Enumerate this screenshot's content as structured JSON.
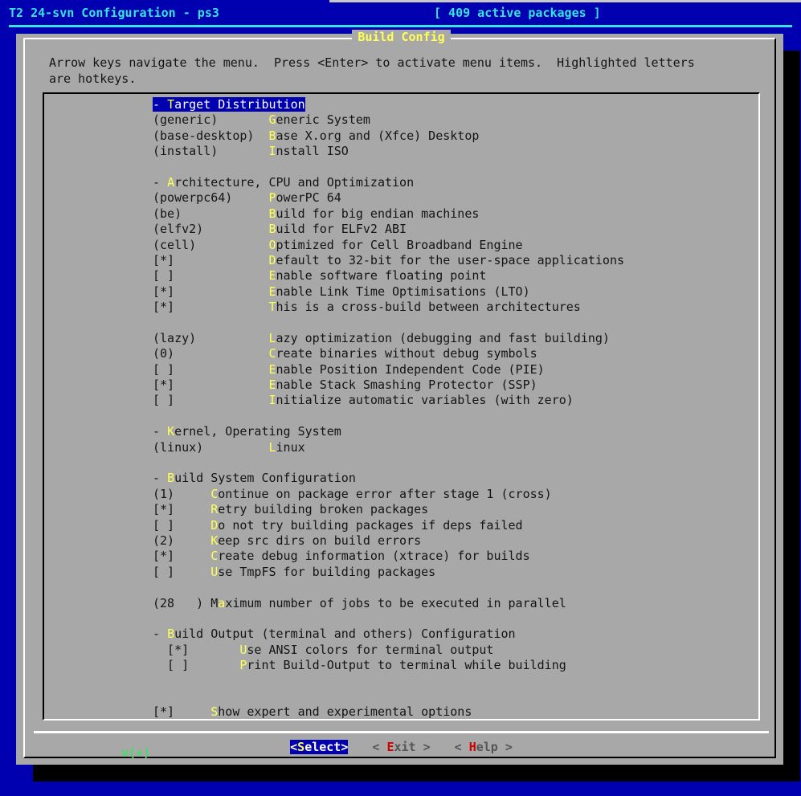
{
  "titlebar": {
    "left": "T2 24-svn Configuration - ps3",
    "right": "[ 409 active packages ]"
  },
  "dialog": {
    "title": "Build Config",
    "prompt_line1": "Arrow keys navigate the menu.  Press <Enter> to activate menu items.  Highlighted letters",
    "prompt_line2": "are hotkeys.",
    "scroll_indicator": "v(+)"
  },
  "colors": {
    "desktop_blue": "#0000b0",
    "dialog_gray": "#a8a8a8",
    "title_yellow": "#ffff55",
    "titlebar_cyan": "#33e5e5",
    "hotkey_yellow": "#ffff55",
    "highlight_blue": "#0000b0",
    "scroll_green": "#44e066",
    "button_hotkey_red": "#cc0000"
  },
  "menu": {
    "rows": [
      {
        "type": "item",
        "selected": true,
        "value": "- ",
        "hotkey": "T",
        "label": "arget Distribution"
      },
      {
        "type": "item",
        "selected": false,
        "value": "(generic)       ",
        "hotkey": "G",
        "label": "eneric System"
      },
      {
        "type": "item",
        "selected": false,
        "value": "(base-desktop)  ",
        "hotkey": "B",
        "label": "ase X.org and (Xfce) Desktop"
      },
      {
        "type": "item",
        "selected": false,
        "value": "(install)       ",
        "hotkey": "I",
        "label": "nstall ISO"
      },
      {
        "type": "blank"
      },
      {
        "type": "item",
        "selected": false,
        "value": "- ",
        "hotkey": "A",
        "label": "rchitecture, CPU and Optimization"
      },
      {
        "type": "item",
        "selected": false,
        "value": "(powerpc64)     ",
        "hotkey": "P",
        "label": "owerPC 64"
      },
      {
        "type": "item",
        "selected": false,
        "value": "(be)            ",
        "hotkey": "B",
        "label": "uild for big endian machines"
      },
      {
        "type": "item",
        "selected": false,
        "value": "(elfv2)         ",
        "hotkey": "B",
        "label": "uild for ELFv2 ABI"
      },
      {
        "type": "item",
        "selected": false,
        "value": "(cell)          ",
        "hotkey": "O",
        "label": "ptimized for Cell Broadband Engine"
      },
      {
        "type": "item",
        "selected": false,
        "value": "[*]             ",
        "hotkey": "D",
        "label": "efault to 32-bit for the user-space applications"
      },
      {
        "type": "item",
        "selected": false,
        "value": "[ ]             ",
        "hotkey": "E",
        "label": "nable software floating point"
      },
      {
        "type": "item",
        "selected": false,
        "value": "[*]             ",
        "hotkey": "E",
        "label": "nable Link Time Optimisations (LTO)"
      },
      {
        "type": "item",
        "selected": false,
        "value": "[*]             ",
        "hotkey": "T",
        "label": "his is a cross-build between architectures"
      },
      {
        "type": "blank"
      },
      {
        "type": "item",
        "selected": false,
        "value": "(lazy)          ",
        "hotkey": "L",
        "label": "azy optimization (debugging and fast building)"
      },
      {
        "type": "item",
        "selected": false,
        "value": "(0)             ",
        "hotkey": "C",
        "label": "reate binaries without debug symbols"
      },
      {
        "type": "item",
        "selected": false,
        "value": "[ ]             ",
        "hotkey": "E",
        "label": "nable Position Independent Code (PIE)"
      },
      {
        "type": "item",
        "selected": false,
        "value": "[*]             ",
        "hotkey": "E",
        "label": "nable Stack Smashing Protector (SSP)"
      },
      {
        "type": "item",
        "selected": false,
        "value": "[ ]             ",
        "hotkey": "I",
        "label": "nitialize automatic variables (with zero)"
      },
      {
        "type": "blank"
      },
      {
        "type": "item",
        "selected": false,
        "value": "- ",
        "hotkey": "K",
        "label": "ernel, Operating System"
      },
      {
        "type": "item",
        "selected": false,
        "value": "(linux)         ",
        "hotkey": "L",
        "label": "inux"
      },
      {
        "type": "blank"
      },
      {
        "type": "item",
        "selected": false,
        "value": "- ",
        "hotkey": "B",
        "label": "uild System Configuration"
      },
      {
        "type": "item",
        "selected": false,
        "value": "(1)     ",
        "hotkey": "C",
        "label": "ontinue on package error after stage 1 (cross)"
      },
      {
        "type": "item",
        "selected": false,
        "value": "[*]     ",
        "hotkey": "R",
        "label": "etry building broken packages"
      },
      {
        "type": "item",
        "selected": false,
        "value": "[ ]     ",
        "hotkey": "D",
        "label": "o not try building packages if deps failed"
      },
      {
        "type": "item",
        "selected": false,
        "value": "(2)     ",
        "hotkey": "K",
        "label": "eep src dirs on build errors"
      },
      {
        "type": "item",
        "selected": false,
        "value": "[*]     ",
        "hotkey": "C",
        "label": "reate debug information (xtrace) for builds"
      },
      {
        "type": "item",
        "selected": false,
        "value": "[ ]     ",
        "hotkey": "U",
        "label": "se TmpFS for building packages"
      },
      {
        "type": "blank"
      },
      {
        "type": "item",
        "selected": false,
        "value": "(28   ) M",
        "hotkey": "a",
        "label": "ximum number of jobs to be executed in parallel"
      },
      {
        "type": "blank"
      },
      {
        "type": "item",
        "selected": false,
        "value": "- ",
        "hotkey": "B",
        "label": "uild Output (terminal and others) Configuration"
      },
      {
        "type": "item",
        "selected": false,
        "value": "  [*]       ",
        "hotkey": "U",
        "label": "se ANSI colors for terminal output"
      },
      {
        "type": "item",
        "selected": false,
        "value": "  [ ]       ",
        "hotkey": "P",
        "label": "rint Build-Output to terminal while building"
      },
      {
        "type": "blank"
      },
      {
        "type": "blank"
      },
      {
        "type": "item",
        "selected": false,
        "value": "[*]     ",
        "hotkey": "S",
        "label": "how expert and experimental options"
      }
    ]
  },
  "buttons": [
    {
      "name": "select",
      "selected": true,
      "open": "<",
      "hotkey": "S",
      "rest": "elect",
      "close": ">"
    },
    {
      "name": "exit",
      "selected": false,
      "open": "< ",
      "hotkey": "E",
      "rest": "xit",
      "close": " >"
    },
    {
      "name": "help",
      "selected": false,
      "open": "< ",
      "hotkey": "H",
      "rest": "elp",
      "close": " >"
    }
  ]
}
